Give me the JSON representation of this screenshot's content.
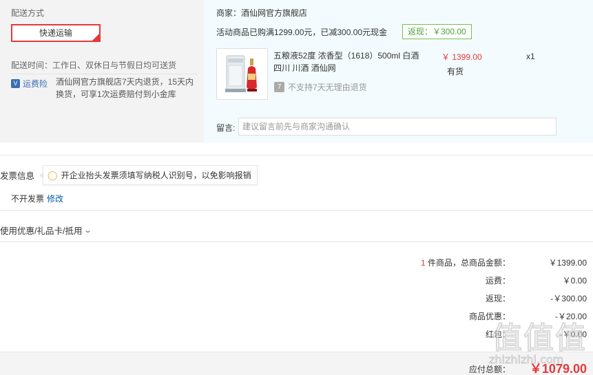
{
  "shipping": {
    "title": "配送方式",
    "method": "快递运输",
    "time": "配送时间：工作日、双休日与节假日均可送货",
    "insurance_badge": "运费险",
    "insurance_icon_letter": "V",
    "insurance_text": "酒仙网官方旗舰店7天内退货，15天内换货，可享1次运费赔付到小金库"
  },
  "seller": {
    "name": "商家：酒仙网官方旗舰店",
    "promo": "活动商品已购满1299.00元，已减300.00元现金",
    "rebate_tag": "返现：￥300.00"
  },
  "product": {
    "name": "五粮液52度 浓香型（1618）500ml 白酒 四川 川酒 酒仙网",
    "price": "￥ 1399.00",
    "stock": "有货",
    "qty": "x1",
    "no_return_icon": "7",
    "no_return": "不支持7天无理由退货"
  },
  "remark": {
    "label": "留言:",
    "placeholder": "建议留言前先与商家沟通确认"
  },
  "invoice": {
    "title": "发票信息",
    "tip": "开企业抬头发票须填写纳税人识别号，以免影响报销",
    "status": "不开发票",
    "edit": "修改"
  },
  "coupon": {
    "label": "使用优惠/礼品卡/抵用"
  },
  "summary": {
    "count": "1",
    "count_suffix": " 件商品，总商品金额：",
    "goods_total": "￥1399.00",
    "freight_label": "运费：",
    "freight": "￥0.00",
    "rebate_label": "返现：",
    "rebate": "-￥300.00",
    "discount_label": "商品优惠：",
    "discount": "-￥20.00",
    "extra_label": "红包：",
    "extra": "-￥0.00",
    "total_label": "应付总额：",
    "total": "￥1079.00"
  },
  "watermark": {
    "logo": "值值值",
    "text": "zhizhizhi.com"
  }
}
